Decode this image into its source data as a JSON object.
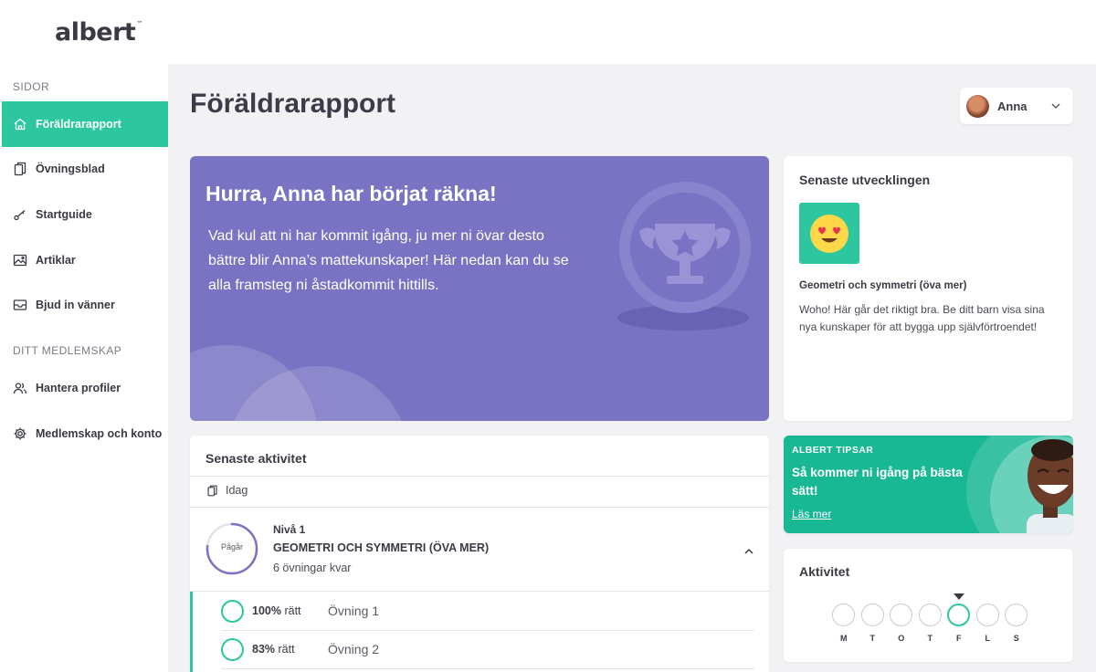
{
  "brand": {
    "logo_text": "albert",
    "logo_mark": "™",
    "accent": "#2cc79f",
    "hero_color": "#7a72c2"
  },
  "sidebar": {
    "section_pages": "SIDOR",
    "section_membership": "DITT MEDLEMSKAP",
    "items": [
      {
        "label": "Föräldrarapport",
        "icon": "home-icon",
        "active": true
      },
      {
        "label": "Övningsblad",
        "icon": "copy-icon",
        "active": false
      },
      {
        "label": "Startguide",
        "icon": "key-icon",
        "active": false
      },
      {
        "label": "Artiklar",
        "icon": "image-icon",
        "active": false
      },
      {
        "label": "Bjud in vänner",
        "icon": "mail-icon",
        "active": false
      },
      {
        "label": "Hantera profiler",
        "icon": "users-icon",
        "active": false
      },
      {
        "label": "Medlemskap och konto",
        "icon": "gear-icon",
        "active": false
      }
    ]
  },
  "header": {
    "title": "Föräldrarapport",
    "profile_name": "Anna"
  },
  "hero": {
    "title": "Hurra, Anna har börjat räkna!",
    "text": "Vad kul att ni har kommit igång, ju mer ni övar desto bättre blir Anna’s mattekunskaper! Här nedan kan du se alla framsteg ni åstadkommit hittills."
  },
  "latest_development": {
    "title": "Senaste utvecklingen",
    "subject": "Geometri och symmetri (öva mer)",
    "text": "Woho! Här går det riktigt bra. Be ditt barn visa sina nya kunskaper för att bygga upp självförtroendet!"
  },
  "tip": {
    "label": "ALBERT TIPSAR",
    "title": "Så kommer ni igång på bästa sätt!",
    "link": "Läs mer"
  },
  "weekly_activity": {
    "title": "Aktivitet",
    "days": [
      "M",
      "T",
      "O",
      "T",
      "F",
      "L",
      "S"
    ],
    "today_index": 4
  },
  "recent_activity": {
    "title": "Senaste aktivitet",
    "date_label": "Idag",
    "status": "Pågår",
    "level": "Nivå 1",
    "topic": "GEOMETRI OCH SYMMETRI (ÖVA MER)",
    "remaining": "6 övningar kvar",
    "exercises": [
      {
        "score_pct": "100%",
        "score_word": "rätt",
        "name": "Övning 1"
      },
      {
        "score_pct": "83%",
        "score_word": "rätt",
        "name": "Övning 2"
      }
    ]
  }
}
